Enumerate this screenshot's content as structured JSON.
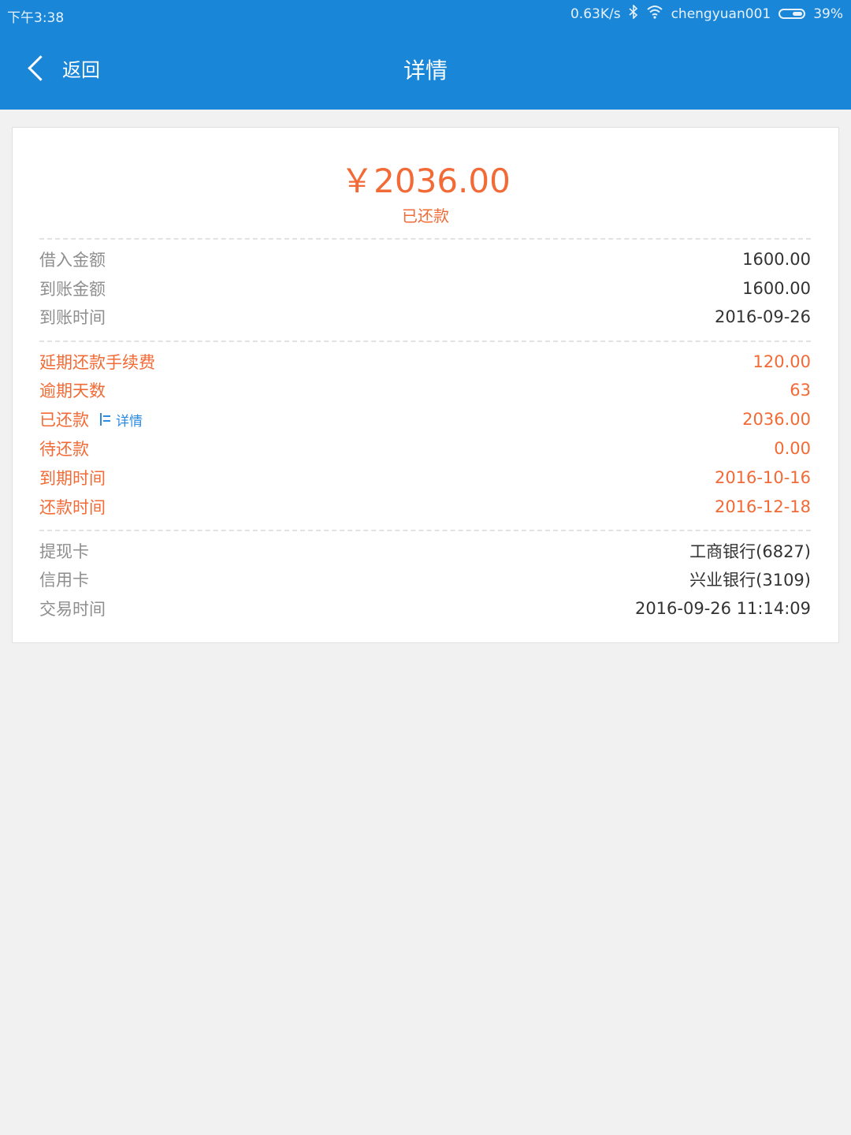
{
  "status_bar": {
    "time": "下午3:38",
    "net_speed": "0.63K/s",
    "bluetooth_icon": "bluetooth-icon",
    "wifi_icon": "wifi-icon",
    "wifi_name": "chengyuan001",
    "battery_percent": "39%"
  },
  "nav": {
    "back_label": "返回",
    "title": "详情"
  },
  "summary": {
    "amount": "￥2036.00",
    "status": "已还款"
  },
  "colors": {
    "header": "#1a86d8",
    "accent": "#f26a35",
    "link": "#2b8be0"
  },
  "section1": [
    {
      "label": "借入金额",
      "value": "1600.00"
    },
    {
      "label": "到账金额",
      "value": "1600.00"
    },
    {
      "label": "到账时间",
      "value": "2016-09-26"
    }
  ],
  "section2": [
    {
      "label": "延期还款手续费",
      "value": "120.00"
    },
    {
      "label": "逾期天数",
      "value": "63"
    },
    {
      "label": "已还款",
      "value": "2036.00",
      "link": "详情"
    },
    {
      "label": "待还款",
      "value": "0.00"
    },
    {
      "label": "到期时间",
      "value": "2016-10-16"
    },
    {
      "label": "还款时间",
      "value": "2016-12-18"
    }
  ],
  "section3": [
    {
      "label": "提现卡",
      "value": "工商银行(6827)"
    },
    {
      "label": "信用卡",
      "value": "兴业银行(3109)"
    },
    {
      "label": "交易时间",
      "value": "2016-09-26 11:14:09"
    }
  ]
}
